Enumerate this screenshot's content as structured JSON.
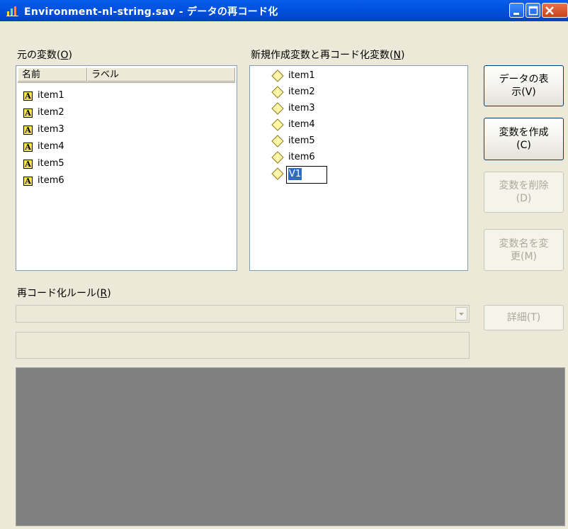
{
  "window": {
    "title": "Environment-nl-string.sav - データの再コード化"
  },
  "source_variables": {
    "label_text": "元の変数(",
    "label_mnemonic": "O",
    "label_suffix": ")",
    "columns": [
      "名前",
      "ラベル"
    ],
    "items": [
      "item1",
      "item2",
      "item3",
      "item4",
      "item5",
      "item6"
    ]
  },
  "new_variables": {
    "label_text": "新規作成変数と再コード化変数(",
    "label_mnemonic": "N",
    "label_suffix": ")",
    "items": [
      "item1",
      "item2",
      "item3",
      "item4",
      "item5",
      "item6"
    ],
    "editing_value": "V1"
  },
  "buttons": {
    "view_data": {
      "line1": "データの表",
      "line2": "示(V)",
      "enabled": true
    },
    "create_variable": {
      "line1": "変数を作成",
      "line2": "(C)",
      "enabled": true
    },
    "delete_variable": {
      "line1": "変数を削除",
      "line2": "(D)",
      "enabled": false
    },
    "rename_variable": {
      "line1": "変数名を変",
      "line2": "更(M)",
      "enabled": false
    },
    "details": {
      "label": "詳細(T)",
      "enabled": false
    }
  },
  "recode_rules": {
    "label_text": "再コード化ルール(",
    "label_mnemonic": "R",
    "label_suffix": ")",
    "selected_value": ""
  },
  "colors": {
    "titlebar": "#0052e0",
    "dialog_bg": "#ece9d8",
    "gray_panel": "#808080",
    "icon_yellow": "#f8e44c",
    "selection": "#316ac5"
  }
}
